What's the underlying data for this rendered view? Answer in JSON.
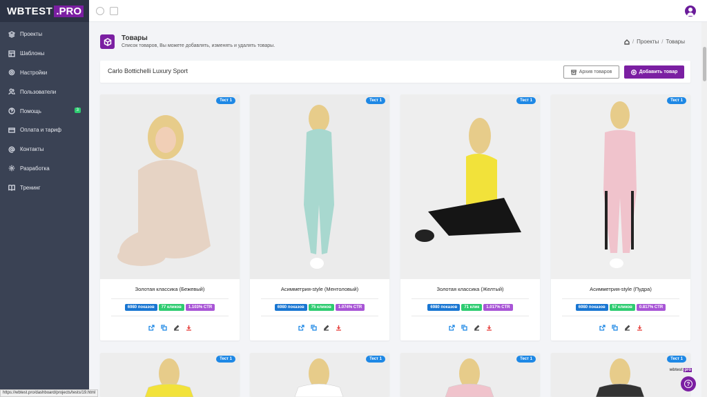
{
  "logo": {
    "text": "WBTEST",
    "pro": ".PRO"
  },
  "sidebar": {
    "items": [
      {
        "label": "Проекты",
        "icon": "layers-icon"
      },
      {
        "label": "Шаблоны",
        "icon": "layout-icon"
      },
      {
        "label": "Настройки",
        "icon": "gear-icon"
      },
      {
        "label": "Пользователи",
        "icon": "users-icon"
      },
      {
        "label": "Помощь",
        "icon": "help-circle-icon",
        "badge": "3"
      },
      {
        "label": "Оплата и тариф",
        "icon": "credit-card-icon"
      },
      {
        "label": "Контакты",
        "icon": "at-sign-icon"
      },
      {
        "label": "Разработка",
        "icon": "settings-icon"
      },
      {
        "label": "Тренинг",
        "icon": "book-icon"
      }
    ]
  },
  "header": {
    "title": "Товары",
    "subtitle": "Список товаров, Вы можете добавлять, изменять и удалять товары.",
    "breadcrumb": [
      "Проекты",
      "Товары"
    ]
  },
  "toolbar": {
    "project_name": "Carlo Bottichelli Luxury Sport",
    "archive_label": "Архив товаров",
    "add_label": "Добавить товар"
  },
  "products": [
    {
      "tag": "Тест 1",
      "name": "Золотая классика (Бежевый)",
      "views": "6980 показов",
      "clicks": "77 кликов",
      "ctr": "1.103% CTR",
      "bg": "#ececec",
      "outfit": "#e6d3c4"
    },
    {
      "tag": "Тест 1",
      "name": "Асимметрия-style (Ментоловый)",
      "views": "6980 показов",
      "clicks": "75 кликов",
      "ctr": "1.074% CTR",
      "bg": "#ebebeb",
      "outfit": "#a8d8cf"
    },
    {
      "tag": "Тест 1",
      "name": "Золотая классика (Желтый)",
      "views": "6980 показов",
      "clicks": "71 клик",
      "ctr": "1.017% CTR",
      "bg": "#eeeeee",
      "outfit": "#f2e23a"
    },
    {
      "tag": "Тест 1",
      "name": "Асимметрия-style (Пудра)",
      "views": "6980 показов",
      "clicks": "57 кликов",
      "ctr": "0.817% CTR",
      "bg": "#efefef",
      "outfit": "#f0c3cc"
    }
  ],
  "products_row2": [
    {
      "tag": "Тест 1",
      "outfit": "#f2e23a"
    },
    {
      "tag": "Тест 1",
      "outfit": "#ffffff"
    },
    {
      "tag": "Тест 1",
      "outfit": "#f0c3cc"
    },
    {
      "tag": "Тест 1",
      "outfit": "#333333"
    }
  ],
  "status_url": "https://wbtest.pro/dashboard/projects/tests/19.html",
  "watermark": {
    "text": "wbtest",
    "pro": "pro"
  }
}
